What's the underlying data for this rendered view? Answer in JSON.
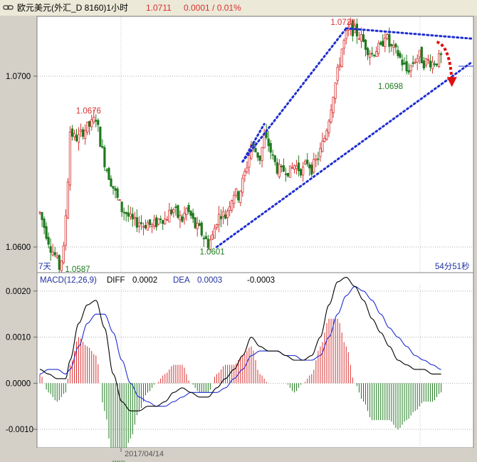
{
  "header": {
    "title": "欧元美元(外汇_D 8160)1小时",
    "price": "1.0711",
    "change": "0.0001 / 0.01%"
  },
  "colors": {
    "up": "#d83030",
    "down": "#1e7a1e",
    "trendline": "#1f2fd0",
    "arrow": "#e01010",
    "diff_line": "#000000",
    "dea_line": "#1f2fd0",
    "label_blue": "#2030a0",
    "panel_bg": "#ffffff",
    "chrome": "#d4d0c8"
  },
  "icons": {
    "link": "link-icon"
  },
  "main_panel": {
    "period_label": "7天",
    "countdown": "54分51秒",
    "annotations": [
      {
        "text": "1.0676",
        "color": "up"
      },
      {
        "text": "1.0601",
        "color": "down"
      },
      {
        "text": "1.0587",
        "color": "down"
      },
      {
        "text": "1.0728",
        "color": "up"
      },
      {
        "text": "1.0698",
        "color": "down"
      }
    ]
  },
  "macd_panel": {
    "label": "MACD(12,26,9)",
    "diff_label": "DIFF",
    "diff_value": "0.0002",
    "dea_label": "DEA",
    "dea_value": "0.0003",
    "macd_value": "-0.0003"
  },
  "x_axis": {
    "date_label": "2017/04/14"
  },
  "chart_data": [
    {
      "type": "candlestick",
      "ylim": [
        1.0585,
        1.0735
      ],
      "y_ticks": [
        "1.0700",
        "1.0600"
      ],
      "grid": true,
      "keypoints": [
        [
          0,
          1.062
        ],
        [
          3,
          1.0608
        ],
        [
          5,
          1.06
        ],
        [
          7,
          1.0595
        ],
        [
          9,
          1.0588
        ],
        [
          11,
          1.0598
        ],
        [
          13,
          1.064
        ],
        [
          14,
          1.0668
        ],
        [
          16,
          1.0664
        ],
        [
          18,
          1.0664
        ],
        [
          20,
          1.0668
        ],
        [
          22,
          1.067
        ],
        [
          24,
          1.0672
        ],
        [
          26,
          1.0676
        ],
        [
          28,
          1.0662
        ],
        [
          30,
          1.065
        ],
        [
          32,
          1.0642
        ],
        [
          34,
          1.0635
        ],
        [
          36,
          1.0628
        ],
        [
          38,
          1.0622
        ],
        [
          40,
          1.062
        ],
        [
          42,
          1.0616
        ],
        [
          44,
          1.0614
        ],
        [
          46,
          1.0615
        ],
        [
          48,
          1.0613
        ],
        [
          50,
          1.0614
        ],
        [
          52,
          1.0612
        ],
        [
          54,
          1.0614
        ],
        [
          56,
          1.0618
        ],
        [
          58,
          1.0616
        ],
        [
          60,
          1.062
        ],
        [
          62,
          1.0622
        ],
        [
          64,
          1.0618
        ],
        [
          66,
          1.0616
        ],
        [
          68,
          1.0622
        ],
        [
          70,
          1.0618
        ],
        [
          72,
          1.0612
        ],
        [
          74,
          1.061
        ],
        [
          76,
          1.0606
        ],
        [
          78,
          1.0602
        ],
        [
          80,
          1.0606
        ],
        [
          82,
          1.0616
        ],
        [
          84,
          1.062
        ],
        [
          86,
          1.0618
        ],
        [
          88,
          1.0626
        ],
        [
          90,
          1.0632
        ],
        [
          92,
          1.063
        ],
        [
          94,
          1.0638
        ],
        [
          96,
          1.0648
        ],
        [
          98,
          1.066
        ],
        [
          100,
          1.0656
        ],
        [
          102,
          1.0652
        ],
        [
          104,
          1.0664
        ],
        [
          106,
          1.066
        ],
        [
          108,
          1.0652
        ],
        [
          110,
          1.0646
        ],
        [
          112,
          1.0644
        ],
        [
          114,
          1.0646
        ],
        [
          116,
          1.0644
        ],
        [
          118,
          1.0648
        ],
        [
          120,
          1.0646
        ],
        [
          122,
          1.0645
        ],
        [
          124,
          1.065
        ],
        [
          126,
          1.0646
        ],
        [
          128,
          1.065
        ],
        [
          130,
          1.0656
        ],
        [
          132,
          1.0664
        ],
        [
          134,
          1.0676
        ],
        [
          136,
          1.069
        ],
        [
          138,
          1.0702
        ],
        [
          140,
          1.0716
        ],
        [
          142,
          1.0724
        ],
        [
          144,
          1.0728
        ],
        [
          146,
          1.0726
        ],
        [
          148,
          1.0724
        ],
        [
          150,
          1.072
        ],
        [
          152,
          1.0716
        ],
        [
          154,
          1.0713
        ],
        [
          156,
          1.0716
        ],
        [
          158,
          1.0716
        ],
        [
          160,
          1.0725
        ],
        [
          162,
          1.0718
        ],
        [
          164,
          1.0715
        ],
        [
          166,
          1.0713
        ],
        [
          168,
          1.0708
        ],
        [
          170,
          1.0703
        ],
        [
          172,
          1.0706
        ],
        [
          174,
          1.071
        ],
        [
          176,
          1.0712
        ],
        [
          178,
          1.0708
        ],
        [
          180,
          1.0709
        ],
        [
          182,
          1.0708
        ],
        [
          184,
          1.0709
        ],
        [
          186,
          1.0711
        ]
      ]
    },
    {
      "type": "line+bar",
      "title": "MACD(12,26,9)",
      "ylim": [
        -0.0014,
        0.0024
      ],
      "y_ticks": [
        "0.0020",
        "0.0010",
        "0.0000",
        "-0.0010"
      ],
      "series": [
        {
          "name": "DIFF",
          "x": [
            0,
            4,
            8,
            12,
            14,
            18,
            22,
            26,
            30,
            34,
            38,
            42,
            46,
            50,
            54,
            58,
            62,
            66,
            70,
            74,
            78,
            82,
            86,
            90,
            94,
            98,
            102,
            106,
            110,
            114,
            118,
            122,
            126,
            130,
            134,
            138,
            142,
            146,
            150,
            154,
            158,
            162,
            166,
            170,
            174,
            178,
            182,
            186
          ],
          "values": [
            0.0003,
            0.0002,
            0.0001,
            0.0001,
            0.0005,
            0.0013,
            0.0017,
            0.0018,
            0.0012,
            0.0002,
            -0.0004,
            -0.0006,
            -0.0006,
            -0.0005,
            -0.0005,
            -0.0004,
            -0.0002,
            -0.0001,
            -0.0002,
            -0.0003,
            -0.0003,
            -0.0001,
            0.0001,
            0.0003,
            0.0006,
            0.001,
            0.0008,
            0.0007,
            0.0007,
            0.0006,
            0.0005,
            0.0005,
            0.0006,
            0.001,
            0.0017,
            0.0022,
            0.0023,
            0.0021,
            0.0018,
            0.0014,
            0.0011,
            0.0008,
            0.0005,
            0.0004,
            0.0003,
            0.0003,
            0.0002,
            0.0002
          ]
        },
        {
          "name": "DEA",
          "x": [
            0,
            4,
            8,
            12,
            14,
            18,
            22,
            26,
            30,
            34,
            38,
            42,
            46,
            50,
            54,
            58,
            62,
            66,
            70,
            74,
            78,
            82,
            86,
            90,
            94,
            98,
            102,
            106,
            110,
            114,
            118,
            122,
            126,
            130,
            134,
            138,
            142,
            146,
            150,
            154,
            158,
            162,
            166,
            170,
            174,
            178,
            182,
            186
          ],
          "values": [
            0.0002,
            0.0003,
            0.0003,
            0.0002,
            0.0003,
            0.0008,
            0.0013,
            0.0015,
            0.0015,
            0.0011,
            0.0005,
            0.0,
            -0.0003,
            -0.0004,
            -0.0005,
            -0.0005,
            -0.0004,
            -0.0003,
            -0.0002,
            -0.0002,
            -0.0002,
            -0.0002,
            -0.0001,
            0.0001,
            0.0003,
            0.0006,
            0.0007,
            0.0007,
            0.0007,
            0.0006,
            0.0006,
            0.0005,
            0.0005,
            0.0006,
            0.001,
            0.0015,
            0.0019,
            0.0021,
            0.002,
            0.0018,
            0.0015,
            0.0012,
            0.001,
            0.0008,
            0.0006,
            0.0005,
            0.0004,
            0.0003
          ]
        }
      ]
    }
  ]
}
